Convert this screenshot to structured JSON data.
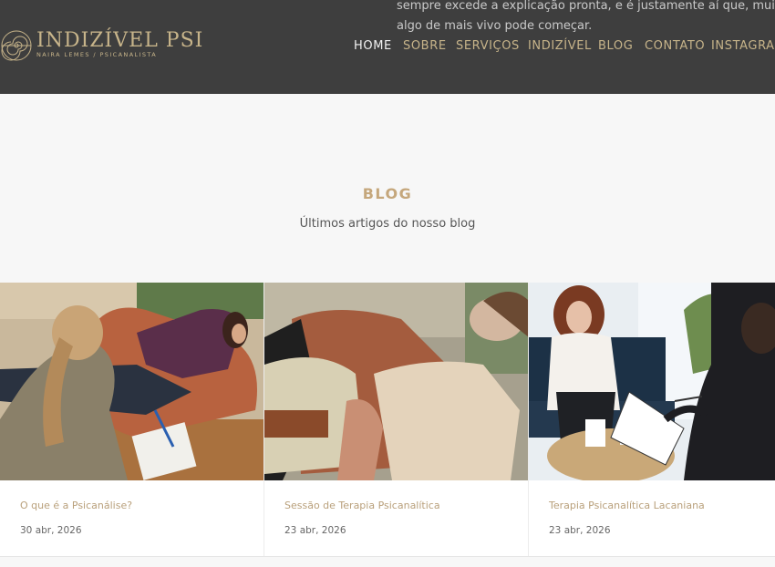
{
  "overlay": {
    "line1": "sempre excede a explicação pronta, e é justamente aí que, muitas vezes,",
    "line2": "algo de mais vivo pode começar."
  },
  "logo": {
    "title": "INDIZÍVEL PSI",
    "subtitle": "NAIRA LEMES / PSICANALISTA"
  },
  "nav": {
    "items": [
      {
        "label": "HOME",
        "active": true
      },
      {
        "label": "SOBRE",
        "active": false
      },
      {
        "label": "SERVIÇOS",
        "active": false
      },
      {
        "label": "INDIZÍVEL",
        "active": false
      },
      {
        "label": "BLOG",
        "active": false
      },
      {
        "label": "CONTATO",
        "active": false
      },
      {
        "label": "INSTAGRAM",
        "active": false
      }
    ]
  },
  "blog": {
    "title": "BLOG",
    "subtitle": "Últimos artigos do nosso blog"
  },
  "posts": [
    {
      "title": "O que é a Psicanálise?",
      "date": "30 abr, 2026"
    },
    {
      "title": "Sessão de Terapia Psicanalítica",
      "date": "23 abr, 2026"
    },
    {
      "title": "Terapia Psicanalítica Lacaniana",
      "date": "23 abr, 2026"
    }
  ],
  "colors": {
    "header_bg": "#3e3e3e",
    "accent_gold": "#c7b48a",
    "page_bg": "#f7f7f7"
  }
}
